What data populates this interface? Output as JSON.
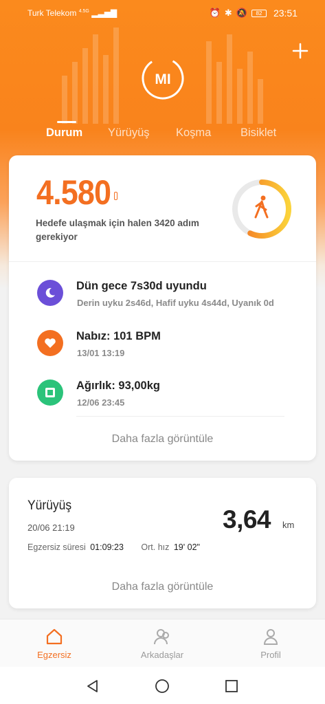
{
  "status_bar": {
    "carrier": "Turk Telekom",
    "network": "4.5G",
    "battery": "82",
    "time": "23:51"
  },
  "header": {
    "logo_text": "MI",
    "tabs": [
      "Durum",
      "Yürüyüş",
      "Koşma",
      "Bisiklet"
    ],
    "active_tab": "Durum",
    "add_icon": "plus-icon"
  },
  "steps_card": {
    "steps": "4.580",
    "goal_text": "Hedefe ulaşmak için halen 3420 adım gerekiyor",
    "progress": 0.57,
    "items": [
      {
        "icon": "sleep-icon",
        "color": "#6b4fd8",
        "title": "Dün gece 7s30d uyundu",
        "sub": "Derin uyku 2s46d, Hafif uyku 4s44d, Uyanık 0d"
      },
      {
        "icon": "heart-icon",
        "color": "#f36f21",
        "title": "Nabız: 101 BPM",
        "sub": "13/01 13:19"
      },
      {
        "icon": "scale-icon",
        "color": "#2bc37a",
        "title": "Ağırlık: 93,00kg",
        "sub": "12/06 23:45"
      }
    ],
    "more_label": "Daha fazla görüntüle"
  },
  "walk_card": {
    "title": "Yürüyüş",
    "date": "20/06 21:19",
    "distance": "3,64",
    "unit": "km",
    "duration_label": "Egzersiz süresi",
    "duration": "01:09:23",
    "pace_label": "Ort. hız",
    "pace": "19' 02\"",
    "more_label": "Daha fazla görüntüle"
  },
  "bottom_nav": [
    {
      "icon": "home-icon",
      "label": "Egzersiz",
      "active": true
    },
    {
      "icon": "friends-icon",
      "label": "Arkadaşlar",
      "active": false
    },
    {
      "icon": "profile-icon",
      "label": "Profil",
      "active": false
    }
  ],
  "colors": {
    "accent": "#f36f21",
    "header": "#fb8a1d"
  }
}
